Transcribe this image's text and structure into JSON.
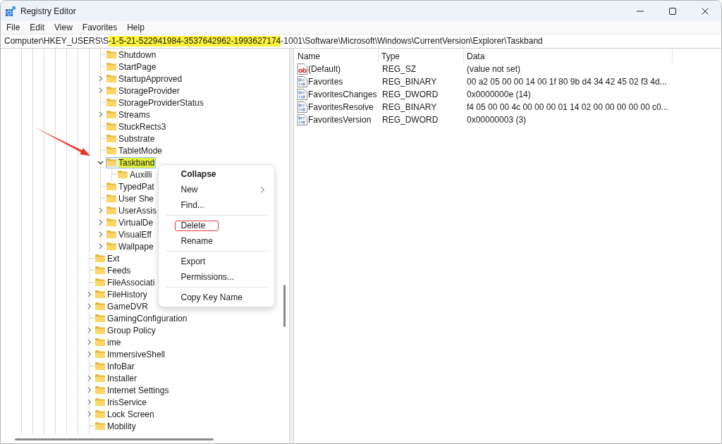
{
  "window": {
    "title": "Registry Editor"
  },
  "menu_bar": [
    "File",
    "Edit",
    "View",
    "Favorites",
    "Help"
  ],
  "address_bar": {
    "segments": [
      {
        "text": "Computer\\HKEY_USERS\\S",
        "highlighted": false
      },
      {
        "text": "-1-5-21-522941984-3537642962-1993627174",
        "highlighted": true
      },
      {
        "text": "-1001\\Software\\Microsoft\\Windows\\CurrentVersion\\Explorer\\Taskband",
        "highlighted": false
      }
    ]
  },
  "tree": {
    "items": [
      {
        "children": [
          {
            "label": "Shutdown",
            "expandable": false,
            "selected": false,
            "highlighted": false
          },
          {
            "label": "StartPage",
            "expandable": false,
            "selected": false,
            "highlighted": false
          },
          {
            "label": "StartupApproved",
            "expandable": true,
            "expanded": false,
            "selected": false,
            "highlighted": false
          },
          {
            "label": "StorageProvider",
            "expandable": true,
            "expanded": false,
            "selected": false,
            "highlighted": false
          },
          {
            "label": "StorageProviderStatus",
            "expandable": false,
            "selected": false,
            "highlighted": false
          },
          {
            "label": "Streams",
            "expandable": true,
            "expanded": false,
            "selected": false,
            "highlighted": false
          },
          {
            "label": "StuckRects3",
            "expandable": false,
            "selected": false,
            "highlighted": false
          },
          {
            "label": "Substrate",
            "expandable": false,
            "selected": false,
            "highlighted": false
          },
          {
            "label": "TabletMode",
            "expandable": false,
            "selected": false,
            "highlighted": false
          },
          {
            "label": "Taskband",
            "expandable": true,
            "expanded": true,
            "selected": true,
            "highlighted": true,
            "children": [
              {
                "label": "Auxilli",
                "expandable": false,
                "selected": false,
                "highlighted": false
              }
            ]
          },
          {
            "label": "TypedPat",
            "expandable": false,
            "selected": false,
            "highlighted": false
          },
          {
            "label": "User She",
            "expandable": false,
            "selected": false,
            "highlighted": false
          },
          {
            "label": "UserAssis",
            "expandable": true,
            "expanded": false,
            "selected": false,
            "highlighted": false
          },
          {
            "label": "VirtualDe",
            "expandable": true,
            "expanded": false,
            "selected": false,
            "highlighted": false
          },
          {
            "label": "VisualEff",
            "expandable": true,
            "expanded": false,
            "selected": false,
            "highlighted": false
          },
          {
            "label": "Wallpape",
            "expandable": true,
            "expanded": false,
            "selected": false,
            "highlighted": false
          }
        ]
      },
      {
        "label": "Ext",
        "expandable": false,
        "selected": false,
        "highlighted": false
      },
      {
        "label": "Feeds",
        "expandable": false,
        "selected": false,
        "highlighted": false
      },
      {
        "label": "FileAssociati",
        "expandable": false,
        "selected": false,
        "highlighted": false
      },
      {
        "label": "FileHistory",
        "expandable": true,
        "expanded": false,
        "selected": false,
        "highlighted": false
      },
      {
        "label": "GameDVR",
        "expandable": true,
        "expanded": false,
        "selected": false,
        "highlighted": false
      },
      {
        "label": "GamingConfiguration",
        "expandable": false,
        "selected": false,
        "highlighted": false
      },
      {
        "label": "Group Policy",
        "expandable": true,
        "expanded": false,
        "selected": false,
        "highlighted": false
      },
      {
        "label": "ime",
        "expandable": true,
        "expanded": false,
        "selected": false,
        "highlighted": false
      },
      {
        "label": "ImmersiveShell",
        "expandable": true,
        "expanded": false,
        "selected": false,
        "highlighted": false
      },
      {
        "label": "InfoBar",
        "expandable": false,
        "selected": false,
        "highlighted": false
      },
      {
        "label": "Installer",
        "expandable": true,
        "expanded": false,
        "selected": false,
        "highlighted": false
      },
      {
        "label": "Internet Settings",
        "expandable": true,
        "expanded": false,
        "selected": false,
        "highlighted": false
      },
      {
        "label": "IrisService",
        "expandable": true,
        "expanded": false,
        "selected": false,
        "highlighted": false
      },
      {
        "label": "Lock Screen",
        "expandable": true,
        "expanded": false,
        "selected": false,
        "highlighted": false
      },
      {
        "label": "Mobility",
        "expandable": false,
        "selected": false,
        "highlighted": false
      }
    ]
  },
  "values": {
    "columns": [
      "Name",
      "Type",
      "Data"
    ],
    "rows": [
      {
        "kind": "string",
        "name": "(Default)",
        "type": "REG_SZ",
        "data": "(value not set)",
        "selected": false
      },
      {
        "kind": "binary",
        "name": "Favorites",
        "type": "REG_BINARY",
        "data": "00 a2 05 00 00 14 00 1f 80 9b d4 34 42 45 02 f3 4d...",
        "selected": false
      },
      {
        "kind": "binary",
        "name": "FavoritesChanges",
        "type": "REG_DWORD",
        "data": "0x0000000e (14)",
        "selected": false
      },
      {
        "kind": "binary",
        "name": "FavoritesResolve",
        "type": "REG_BINARY",
        "data": "f4 05 00 00 4c 00 00 00 01 14 02 00 00 00 00 00 c0...",
        "selected": false
      },
      {
        "kind": "binary",
        "name": "FavoritesVersion",
        "type": "REG_DWORD",
        "data": "0x00000003 (3)",
        "selected": false
      }
    ]
  },
  "context_menu": {
    "groups": [
      [
        {
          "label": "Collapse",
          "default": true,
          "submenu": false,
          "outlined": false
        },
        {
          "label": "New",
          "default": false,
          "submenu": true,
          "outlined": false
        },
        {
          "label": "Find...",
          "default": false,
          "submenu": false,
          "outlined": false
        }
      ],
      [
        {
          "label": "Delete",
          "default": false,
          "submenu": false,
          "outlined": true
        },
        {
          "label": "Rename",
          "default": false,
          "submenu": false,
          "outlined": false
        }
      ],
      [
        {
          "label": "Export",
          "default": false,
          "submenu": false,
          "outlined": false
        },
        {
          "label": "Permissions...",
          "default": false,
          "submenu": false,
          "outlined": false
        }
      ],
      [
        {
          "label": "Copy Key Name",
          "default": false,
          "submenu": false,
          "outlined": false
        }
      ]
    ]
  }
}
